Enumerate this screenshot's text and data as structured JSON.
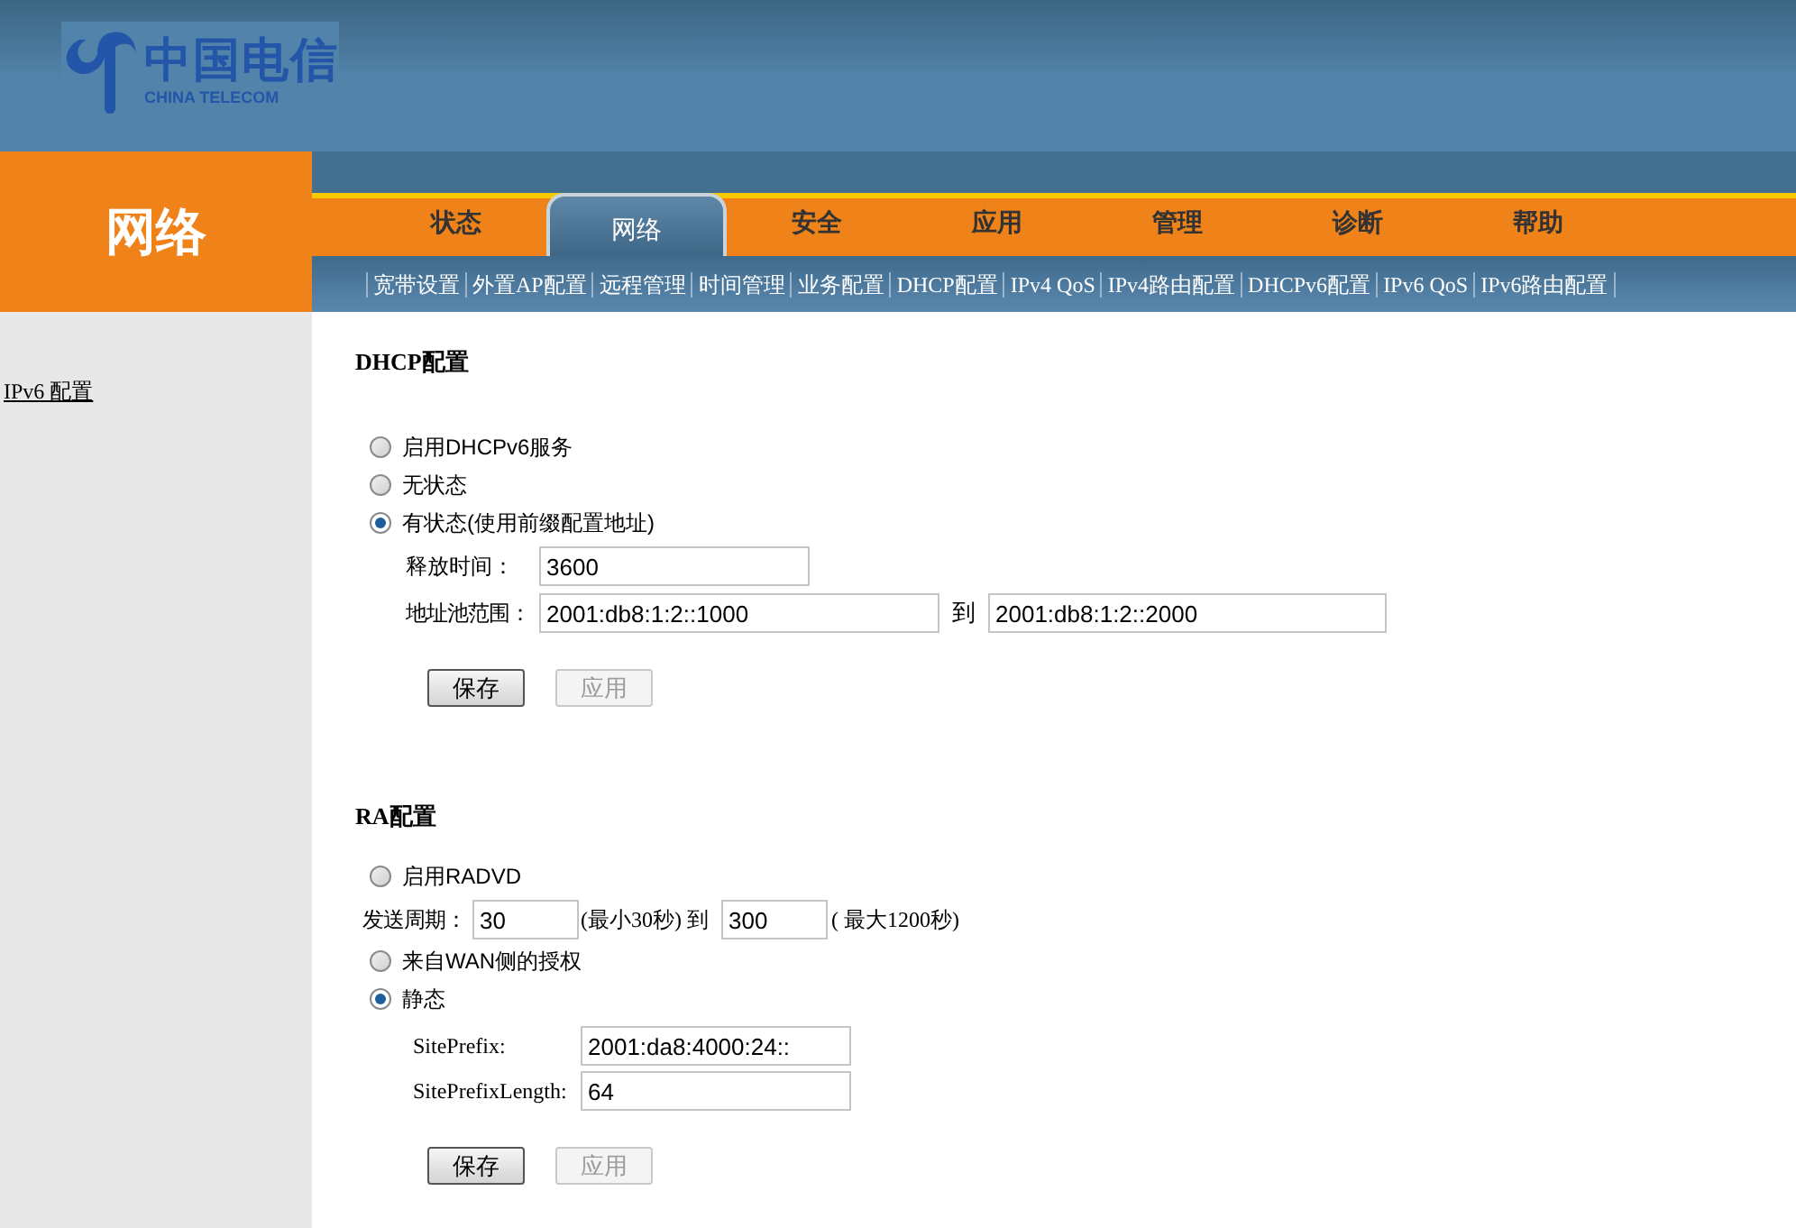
{
  "logo": {
    "name": "中国电信",
    "tagline": "CHINA TELECOM"
  },
  "section_title": "网络",
  "tabs": [
    {
      "label": "状态",
      "selected": false
    },
    {
      "label": "网络",
      "selected": true
    },
    {
      "label": "安全",
      "selected": false
    },
    {
      "label": "应用",
      "selected": false
    },
    {
      "label": "管理",
      "selected": false
    },
    {
      "label": "诊断",
      "selected": false
    },
    {
      "label": "帮助",
      "selected": false
    }
  ],
  "subnav": [
    "宽带设置",
    "外置AP配置",
    "远程管理",
    "时间管理",
    "业务配置",
    "DHCP配置",
    "IPv4 QoS",
    "IPv4路由配置",
    "DHCPv6配置",
    "IPv6 QoS",
    "IPv6路由配置"
  ],
  "sidebar": {
    "items": [
      "IPv6 配置"
    ]
  },
  "dhcp": {
    "title": "DHCP配置",
    "options": [
      {
        "label": "启用DHCPv6服务",
        "selected": false
      },
      {
        "label": "无状态",
        "selected": false
      },
      {
        "label": "有状态(使用前缀配置地址)",
        "selected": true
      }
    ],
    "lease": {
      "label": "释放时间：",
      "value": "3600"
    },
    "pool": {
      "label": "地址池范围：",
      "start": "2001:db8:1:2::1000",
      "separator": "到",
      "end": "2001:db8:1:2::2000"
    },
    "buttons": [
      {
        "label": "保存",
        "disabled": false
      },
      {
        "label": "应用",
        "disabled": true
      }
    ]
  },
  "ra": {
    "title": "RA配置",
    "enable": {
      "label": "启用RADVD",
      "selected": false
    },
    "period": {
      "label": "发送周期：",
      "min": "30",
      "min_note": "(最小30秒) 到",
      "max": "300",
      "max_note": "( 最大1200秒)"
    },
    "modes": [
      {
        "label": "来自WAN侧的授权",
        "selected": false
      },
      {
        "label": "静态",
        "selected": true
      }
    ],
    "fields": [
      {
        "label": "SitePrefix:",
        "value": "2001:da8:4000:24::"
      },
      {
        "label": "SitePrefixLength:",
        "value": "64"
      }
    ],
    "buttons": [
      {
        "label": "保存",
        "disabled": false
      },
      {
        "label": "应用",
        "disabled": true
      }
    ]
  }
}
